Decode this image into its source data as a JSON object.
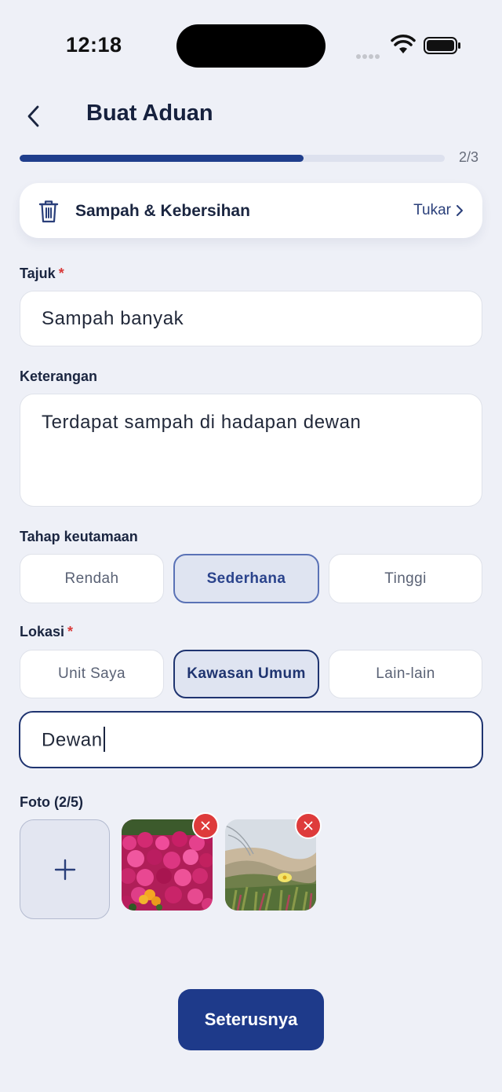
{
  "status_bar": {
    "time": "12:18"
  },
  "header": {
    "title": "Buat Aduan"
  },
  "progress": {
    "text": "2/3",
    "fraction": 0.667
  },
  "category": {
    "name": "Sampah & Kebersihan",
    "change_label": "Tukar",
    "icon": "trash-icon"
  },
  "title_field": {
    "label": "Tajuk",
    "required_mark": "*",
    "value": "Sampah banyak"
  },
  "description_field": {
    "label": "Keterangan",
    "value": "Terdapat sampah di hadapan dewan"
  },
  "priority": {
    "label": "Tahap keutamaan",
    "options": [
      "Rendah",
      "Sederhana",
      "Tinggi"
    ],
    "selected": "Sederhana"
  },
  "location": {
    "label": "Lokasi",
    "required_mark": "*",
    "options": [
      "Unit Saya",
      "Kawasan Umum",
      "Lain-lain"
    ],
    "selected": "Kawasan Umum",
    "input_value": "Dewan"
  },
  "photos": {
    "label": "Foto (2/5)",
    "count": 2,
    "max": 5
  },
  "footer": {
    "next_label": "Seterusnya"
  },
  "colors": {
    "primary": "#1e3a8a",
    "required": "#d93a3a",
    "remove": "#de3b3b",
    "background": "#eef0f7"
  }
}
